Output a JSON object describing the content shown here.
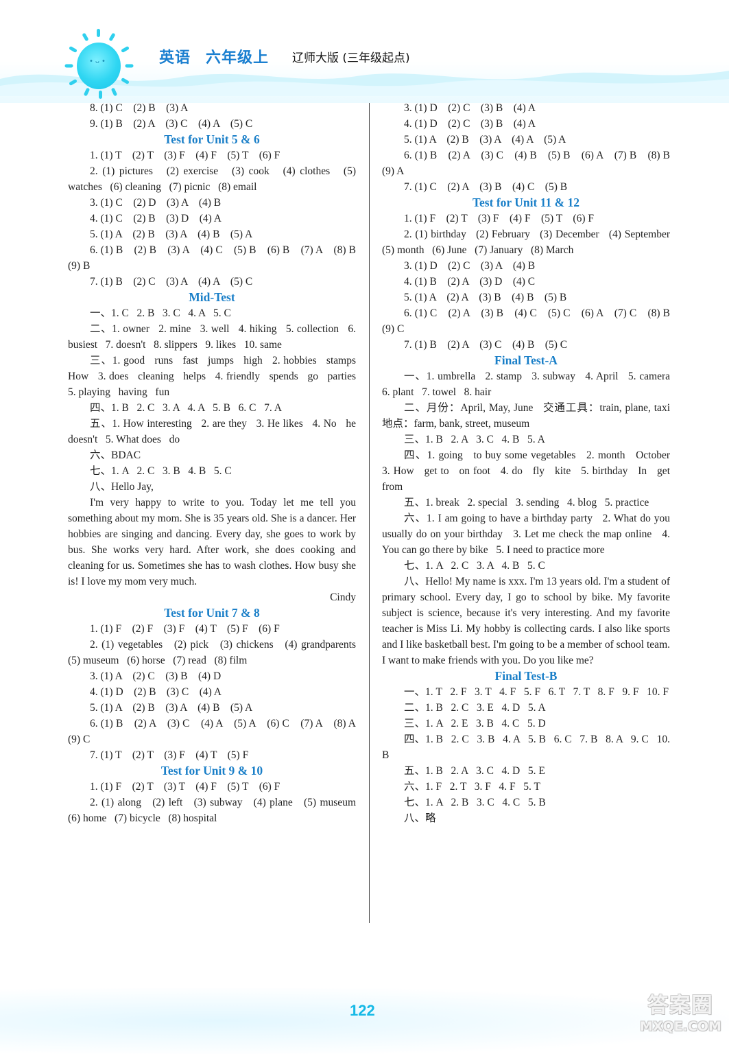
{
  "header": {
    "subject": "英语",
    "grade": "六年级上",
    "edition": "辽师大版 (三年级起点)",
    "sun_face": "•ᴗ•"
  },
  "left_column": [
    {
      "type": "line",
      "indent": true,
      "text": "8. (1) C    (2) B    (3) A"
    },
    {
      "type": "line",
      "indent": true,
      "text": "9. (1) B    (2) A    (3) C    (4) A    (5) C"
    },
    {
      "type": "title",
      "text": "Test for Unit 5 & 6"
    },
    {
      "type": "line",
      "indent": true,
      "text": "1. (1) T    (2) T    (3) F    (4) F    (5) T    (6) F"
    },
    {
      "type": "line",
      "indent": true,
      "text": "2. (1) pictures   (2) exercise   (3) cook   (4) clothes   (5) watches   (6) cleaning   (7) picnic   (8) email"
    },
    {
      "type": "line",
      "indent": true,
      "text": "3. (1) C    (2) D    (3) A    (4) B"
    },
    {
      "type": "line",
      "indent": true,
      "text": "4. (1) C    (2) B    (3) D    (4) A"
    },
    {
      "type": "line",
      "indent": true,
      "text": "5. (1) A    (2) B    (3) A    (4) B    (5) A"
    },
    {
      "type": "line",
      "indent": true,
      "text": "6. (1) B    (2) B    (3) A    (4) C    (5) B    (6) B    (7) A    (8) B    (9) B"
    },
    {
      "type": "line",
      "indent": true,
      "text": "7. (1) B    (2) C    (3) A    (4) A    (5) C"
    },
    {
      "type": "title",
      "text": "Mid-Test"
    },
    {
      "type": "line",
      "indent": true,
      "text": "一、1. C   2. B   3. C   4. A   5. C"
    },
    {
      "type": "line",
      "indent": true,
      "text": "二、1. owner   2. mine   3. well   4. hiking   5. collection   6. busiest   7. doesn't   8. slippers   9. likes   10. same"
    },
    {
      "type": "line",
      "indent": true,
      "text": "三、1. good   runs   fast   jumps   high   2. hobbies   stamps   How   3. does   cleaning   helps   4. friendly   spends   go   parties   5. playing   having   fun"
    },
    {
      "type": "line",
      "indent": true,
      "text": "四、1. B   2. C   3. A   4. A   5. B   6. C   7. A"
    },
    {
      "type": "line",
      "indent": true,
      "text": "五、1. How interesting   2. are they   3. He likes   4. No   he doesn't   5. What does   do"
    },
    {
      "type": "line",
      "indent": true,
      "text": "六、BDAC"
    },
    {
      "type": "line",
      "indent": true,
      "text": "七、1. A   2. C   3. B   4. B   5. C"
    },
    {
      "type": "line",
      "indent": true,
      "text": "八、Hello Jay,"
    },
    {
      "type": "line",
      "indent": true,
      "text": "I'm very happy to write to you. Today let me tell you something about my mom. She is 35 years old. She is a dancer. Her hobbies are singing and dancing. Every day, she goes to work by bus. She works very hard. After work, she does cooking and cleaning for us. Sometimes she has to wash clothes. How busy she is! I love my mom very much."
    },
    {
      "type": "signature",
      "text": "Cindy"
    },
    {
      "type": "title",
      "text": "Test for Unit 7 & 8"
    },
    {
      "type": "line",
      "indent": true,
      "text": "1. (1) F    (2) F    (3) F    (4) T    (5) F    (6) F"
    },
    {
      "type": "line",
      "indent": true,
      "text": "2. (1) vegetables   (2) pick   (3) chickens   (4) grandparents   (5) museum   (6) horse   (7) read   (8) film"
    },
    {
      "type": "line",
      "indent": true,
      "text": "3. (1) A    (2) C    (3) B    (4) D"
    },
    {
      "type": "line",
      "indent": true,
      "text": "4. (1) D    (2) B    (3) C    (4) A"
    },
    {
      "type": "line",
      "indent": true,
      "text": "5. (1) A    (2) B    (3) A    (4) B    (5) A"
    },
    {
      "type": "line",
      "indent": true,
      "text": "6. (1) B    (2) A    (3) C    (4) A    (5) A    (6) C    (7) A    (8) A    (9) C"
    },
    {
      "type": "line",
      "indent": true,
      "text": "7. (1) T    (2) T    (3) F    (4) T    (5) F"
    },
    {
      "type": "title",
      "text": "Test for Unit 9 & 10"
    },
    {
      "type": "line",
      "indent": true,
      "text": "1. (1) F    (2) T    (3) T    (4) F    (5) T    (6) F"
    },
    {
      "type": "line",
      "indent": true,
      "text": "2. (1) along   (2) left   (3) subway   (4) plane   (5) museum   (6) home   (7) bicycle   (8) hospital"
    }
  ],
  "right_column": [
    {
      "type": "line",
      "indent": true,
      "text": "3. (1) D    (2) C    (3) B    (4) A"
    },
    {
      "type": "line",
      "indent": true,
      "text": "4. (1) D    (2) C    (3) B    (4) A"
    },
    {
      "type": "line",
      "indent": true,
      "text": "5. (1) A    (2) B    (3) A    (4) A    (5) A"
    },
    {
      "type": "line",
      "indent": true,
      "text": "6. (1) B    (2) A    (3) C    (4) B    (5) B    (6) A    (7) B    (8) B    (9) A"
    },
    {
      "type": "line",
      "indent": true,
      "text": "7. (1) C    (2) A    (3) B    (4) C    (5) B"
    },
    {
      "type": "title",
      "text": "Test for Unit 11 & 12"
    },
    {
      "type": "line",
      "indent": true,
      "text": "1. (1) F    (2) T    (3) F    (4) F    (5) T    (6) F"
    },
    {
      "type": "line",
      "indent": true,
      "text": "2. (1) birthday   (2) February   (3) December   (4) September   (5) month   (6) June   (7) January   (8) March"
    },
    {
      "type": "line",
      "indent": true,
      "text": "3. (1) D    (2) C    (3) A    (4) B"
    },
    {
      "type": "line",
      "indent": true,
      "text": "4. (1) B    (2) A    (3) D    (4) C"
    },
    {
      "type": "line",
      "indent": true,
      "text": "5. (1) A    (2) A    (3) B    (4) B    (5) B"
    },
    {
      "type": "line",
      "indent": true,
      "text": "6. (1) C    (2) A    (3) B    (4) C    (5) C    (6) A    (7) C    (8) B    (9) C"
    },
    {
      "type": "line",
      "indent": true,
      "text": "7. (1) B    (2) A    (3) C    (4) B    (5) C"
    },
    {
      "type": "title",
      "text": "Final Test-A"
    },
    {
      "type": "line",
      "indent": true,
      "text": "一、1. umbrella   2. stamp   3. subway   4. April   5. camera   6. plant   7. towel   8. hair"
    },
    {
      "type": "line",
      "indent": true,
      "text": "二、月份：April, May, June   交通工具：train, plane, taxi   地点：farm, bank, street, museum"
    },
    {
      "type": "line",
      "indent": true,
      "text": "三、1. B   2. A   3. C   4. B   5. A"
    },
    {
      "type": "line",
      "indent": true,
      "text": "四、1. going   to buy some vegetables   2. month   October   3. How   get to   on foot   4. do   fly   kite   5. birthday   In   get   from"
    },
    {
      "type": "line",
      "indent": true,
      "text": "五、1. break   2. special   3. sending   4. blog   5. practice"
    },
    {
      "type": "line",
      "indent": true,
      "text": "六、1. I am going to have a birthday party   2. What do you usually do on your birthday   3. Let me check the map online   4. You can go there by bike   5. I need to practice more"
    },
    {
      "type": "line",
      "indent": true,
      "text": "七、1. A   2. C   3. A   4. B   5. C"
    },
    {
      "type": "line",
      "indent": true,
      "text": "八、Hello! My name is xxx. I'm 13 years old. I'm a student of primary school. Every day, I go to school by bike. My favorite subject is science, because it's very interesting. And my favorite teacher is Miss Li. My hobby is collecting cards. I also like sports and I like basketball best. I'm going to be a member of school team. I want to make friends with you. Do you like me?"
    },
    {
      "type": "title",
      "text": "Final Test-B"
    },
    {
      "type": "line",
      "indent": true,
      "text": "一、1. T   2. F   3. T   4. F   5. F   6. T   7. T   8. F   9. F   10. F"
    },
    {
      "type": "line",
      "indent": true,
      "text": "二、1. B   2. C   3. E   4. D   5. A"
    },
    {
      "type": "line",
      "indent": true,
      "text": "三、1. A   2. E   3. B   4. C   5. D"
    },
    {
      "type": "line",
      "indent": true,
      "text": "四、1. B   2. C   3. B   4. A   5. B   6. C   7. B   8. A   9. C   10. B"
    },
    {
      "type": "line",
      "indent": true,
      "text": "五、1. B   2. A   3. C   4. D   5. E"
    },
    {
      "type": "line",
      "indent": true,
      "text": "六、1. F   2. T   3. F   4. F   5. T"
    },
    {
      "type": "line",
      "indent": true,
      "text": "七、1. A   2. B   3. C   4. C   5. B"
    },
    {
      "type": "line",
      "indent": true,
      "text": "八、略"
    }
  ],
  "footer": {
    "page_number": "122",
    "watermark_cn": "答案圈",
    "watermark_en": "MXQE.COM"
  },
  "colors": {
    "accent_title": "#1a7fc8",
    "page_number": "#16b9e6",
    "sun": "#2fd6f2"
  }
}
